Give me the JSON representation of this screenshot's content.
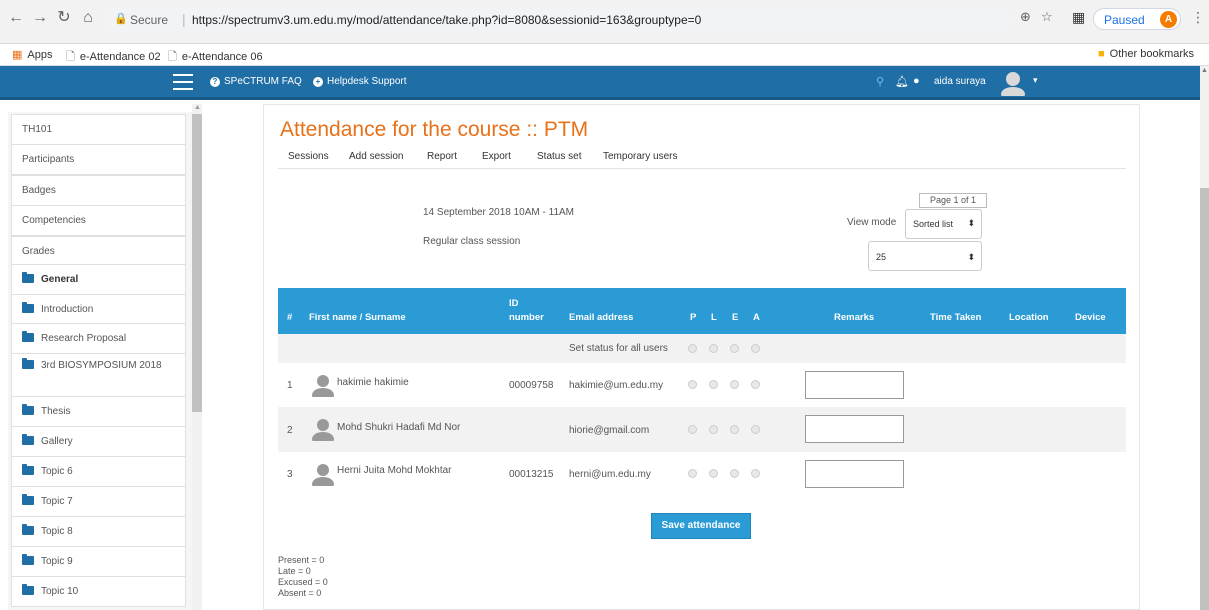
{
  "browser": {
    "secure_label": "Secure",
    "url": "https://spectrumv3.um.edu.my/mod/attendance/take.php?id=8080&sessionid=163&grouptype=0",
    "profile_status": "Paused",
    "profile_initial": "A"
  },
  "bookmarks": {
    "apps": "Apps",
    "items": [
      "e-Attendance 02",
      "e-Attendance 06"
    ],
    "other": "Other bookmarks"
  },
  "navbar": {
    "faq": "SPeCTRUM FAQ",
    "helpdesk": "Helpdesk Support",
    "user_name": "aida suraya"
  },
  "sidebar": {
    "items": [
      "TH101",
      "Participants",
      "Badges",
      "Competencies",
      "Grades"
    ],
    "folders": [
      "General",
      "Introduction",
      "Research Proposal",
      "3rd BIOSYMPOSIUM 2018",
      "Thesis",
      "Gallery",
      "Topic 6",
      "Topic 7",
      "Topic 8",
      "Topic 9",
      "Topic 10"
    ]
  },
  "page": {
    "title": "Attendance for the course :: PTM",
    "tabs": [
      "Sessions",
      "Add session",
      "Report",
      "Export",
      "Status set",
      "Temporary users"
    ],
    "session_date": "14 September 2018 10AM - 11AM",
    "session_desc": "Regular class session",
    "pagination": "Page 1 of 1",
    "view_mode_label": "View mode",
    "view_mode_value": "Sorted list",
    "per_page_value": "25"
  },
  "table": {
    "headers": {
      "num": "#",
      "name": "First name / Surname",
      "id_line1": "ID",
      "id_line2": "number",
      "email": "Email address",
      "p": "P",
      "l": "L",
      "e": "E",
      "a": "A",
      "remarks": "Remarks",
      "time": "Time Taken",
      "location": "Location",
      "device": "Device"
    },
    "set_status_label": "Set status for all users",
    "rows": [
      {
        "num": "1",
        "name": "hakimie hakimie",
        "id": "00009758",
        "email": "hakimie@um.edu.my"
      },
      {
        "num": "2",
        "name": "Mohd Shukri Hadafi Md Nor",
        "id": "",
        "email": "hiorie@gmail.com"
      },
      {
        "num": "3",
        "name": "Herni Juita Mohd Mokhtar",
        "id": "00013215",
        "email": "herni@um.edu.my"
      }
    ]
  },
  "actions": {
    "save": "Save attendance"
  },
  "summary": [
    "Present = 0",
    "Late = 0",
    "Excused = 0",
    "Absent = 0"
  ]
}
